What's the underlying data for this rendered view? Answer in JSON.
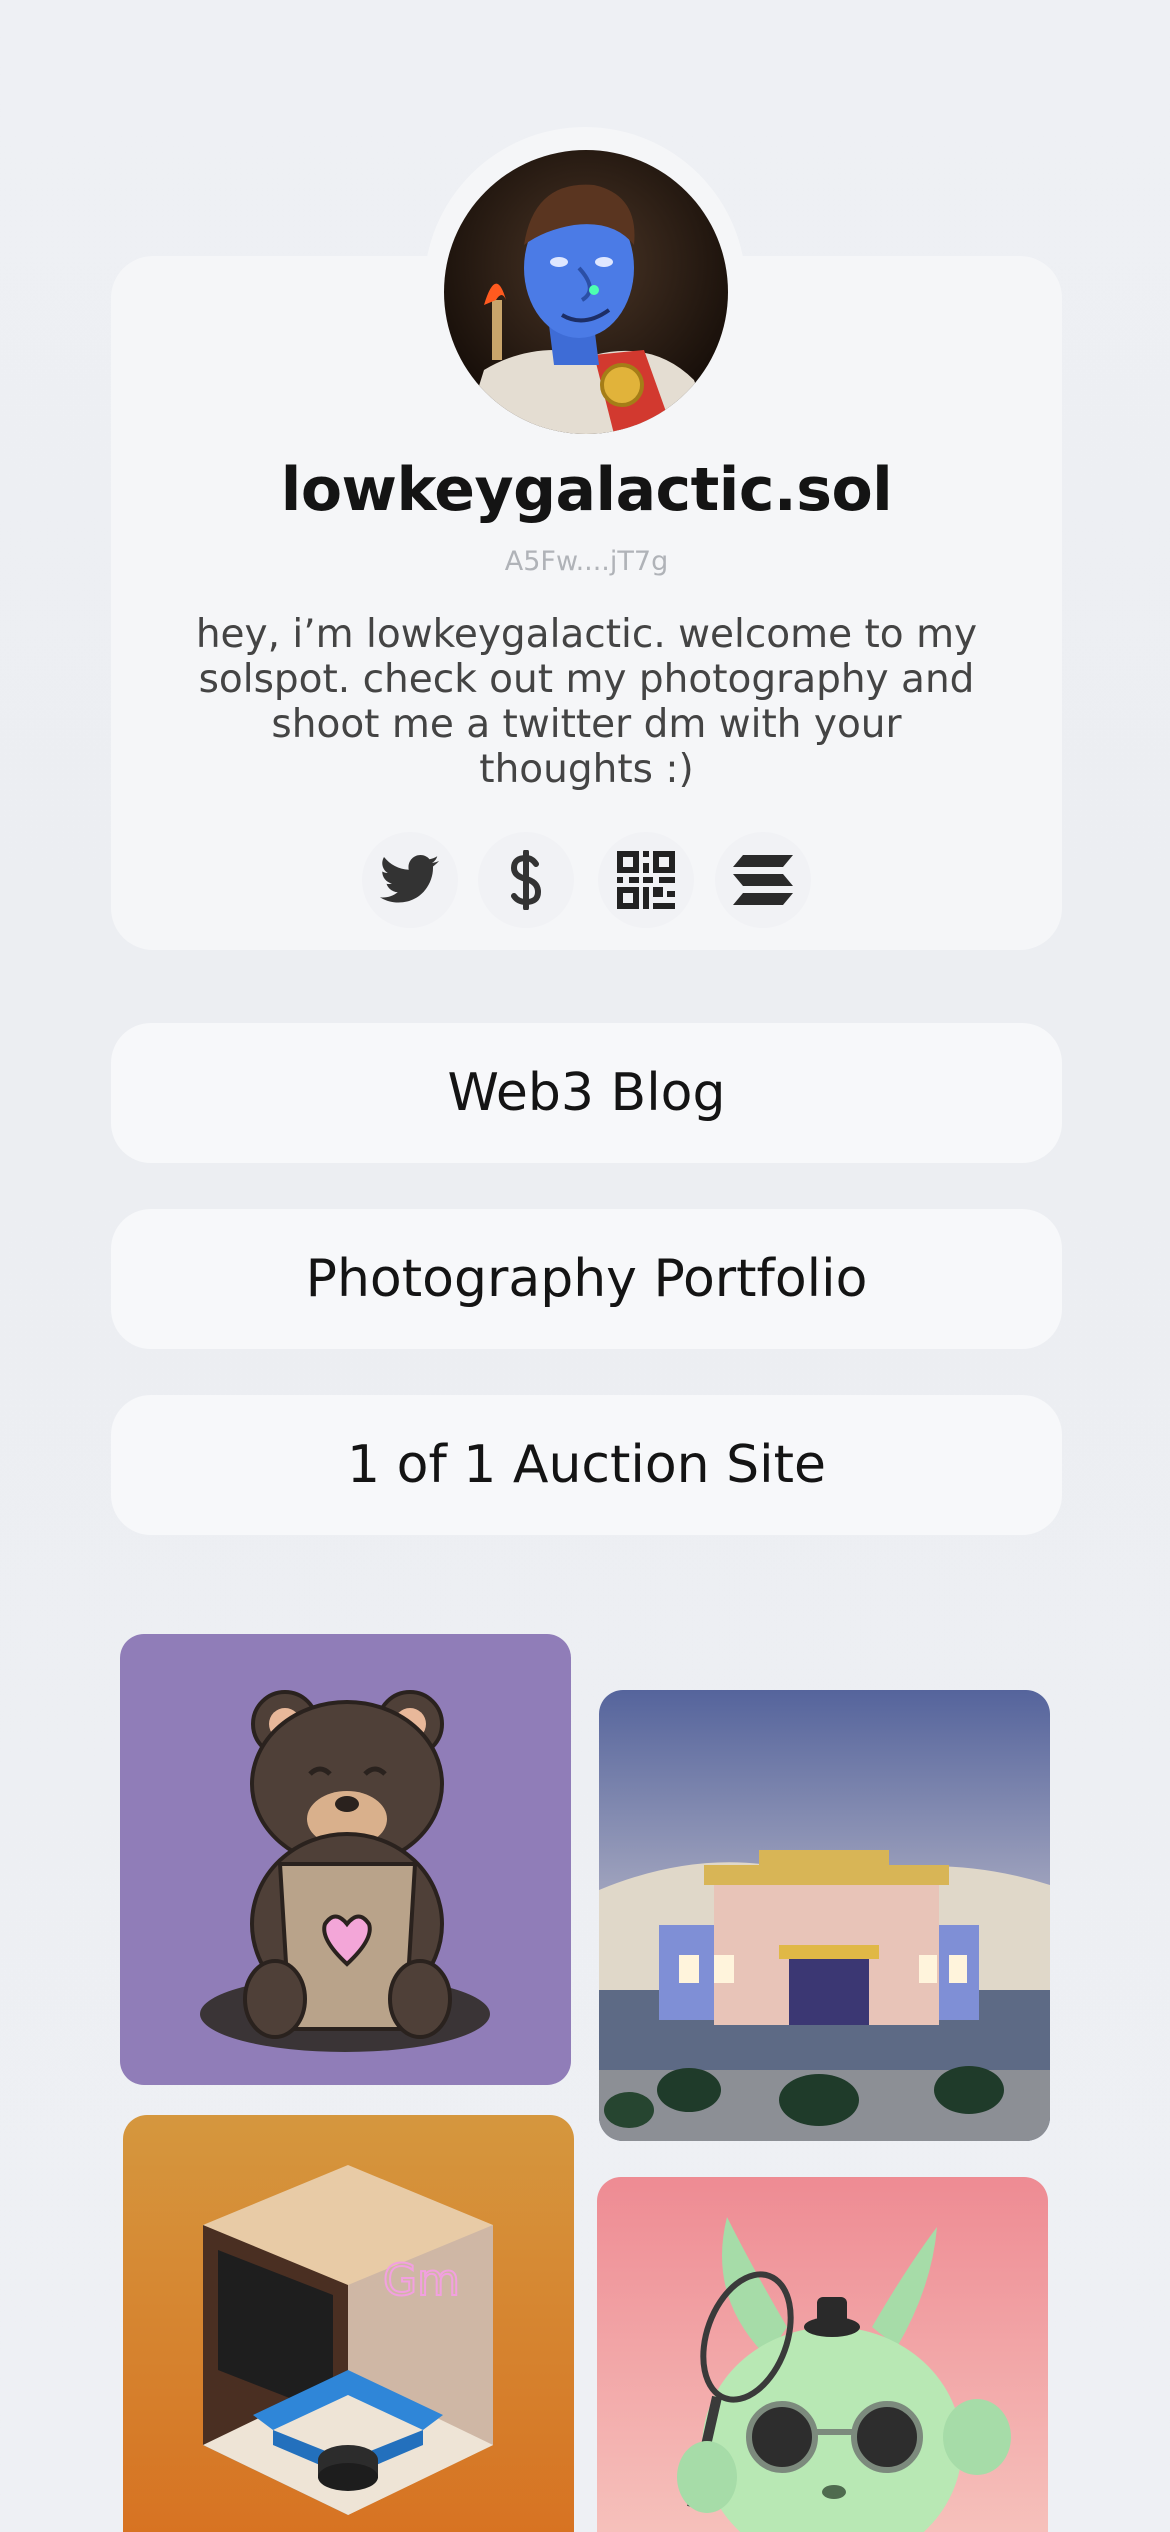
{
  "profile": {
    "username": "lowkeygalactic.sol",
    "wallet": "A5Fw....jT7g",
    "bio": "hey, i’m lowkeygalactic. welcome to my solspot. check out my photography and shoot me a twitter dm with your thoughts :)"
  },
  "socials": [
    {
      "name": "twitter",
      "icon": "twitter-bird-icon"
    },
    {
      "name": "tip",
      "icon": "dollar-sign-icon"
    },
    {
      "name": "qr",
      "icon": "qr-code-icon"
    },
    {
      "name": "solana",
      "icon": "solana-logo-icon"
    }
  ],
  "links": [
    {
      "label": "Web3 Blog"
    },
    {
      "label": "Photography Portfolio"
    },
    {
      "label": "1 of 1 Auction Site"
    }
  ],
  "gallery": [
    {
      "name": "teddy-bear-nft",
      "bg": "#907db8"
    },
    {
      "name": "desert-building-nft",
      "bg": "#6f7aa8"
    },
    {
      "name": "isometric-room-nft",
      "bg": "#d9913f"
    },
    {
      "name": "green-rabbit-nft",
      "bg": "#f4a8a8"
    }
  ],
  "colors": {
    "background": "#eef0f4",
    "card": "#f5f6f8",
    "text": "#141414",
    "muted": "#b0b3b8"
  }
}
